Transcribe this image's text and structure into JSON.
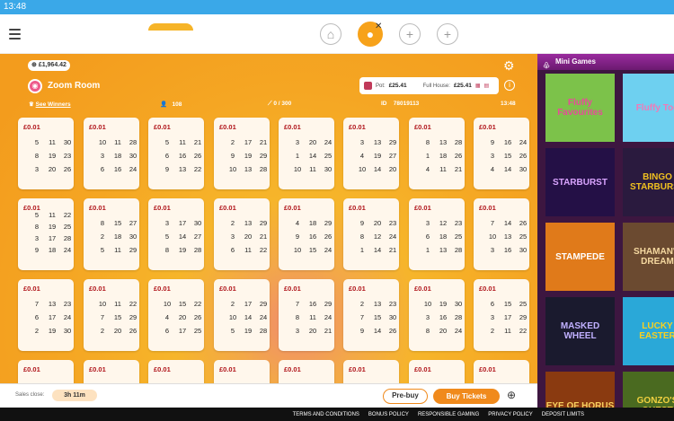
{
  "status": {
    "time": "13:48"
  },
  "nav": {
    "home_icon": "home-icon",
    "add_label": "+"
  },
  "room": {
    "balance": "£1,964.42",
    "title": "Zoom Room",
    "see_winners": "See Winners",
    "players": "108",
    "tickets": "0 / 300",
    "id_label": "ID",
    "id_value": "78019113",
    "time": "13:48",
    "pot_label": "Pot:",
    "pot_value": "£25.41",
    "full_house_label": "Full House:",
    "full_house_value": "£25.41"
  },
  "tickets": [
    {
      "price": "£0.01",
      "nums": [
        "5",
        "11",
        "30",
        "8",
        "19",
        "23",
        "3",
        "20",
        "26"
      ]
    },
    {
      "price": "£0.01",
      "nums": [
        "10",
        "11",
        "28",
        "3",
        "18",
        "30",
        "6",
        "16",
        "24"
      ]
    },
    {
      "price": "£0.01",
      "nums": [
        "5",
        "11",
        "21",
        "6",
        "16",
        "26",
        "9",
        "13",
        "22"
      ]
    },
    {
      "price": "£0.01",
      "nums": [
        "2",
        "17",
        "21",
        "9",
        "19",
        "29",
        "10",
        "13",
        "28"
      ]
    },
    {
      "price": "£0.01",
      "nums": [
        "3",
        "20",
        "24",
        "1",
        "14",
        "25",
        "10",
        "11",
        "30"
      ]
    },
    {
      "price": "£0.01",
      "nums": [
        "3",
        "13",
        "29",
        "4",
        "19",
        "27",
        "10",
        "14",
        "20"
      ]
    },
    {
      "price": "£0.01",
      "nums": [
        "8",
        "13",
        "28",
        "1",
        "18",
        "26",
        "4",
        "11",
        "21"
      ]
    },
    {
      "price": "£0.01",
      "nums": [
        "9",
        "16",
        "24",
        "3",
        "15",
        "26",
        "4",
        "14",
        "30"
      ]
    },
    {
      "price": "£0.01",
      "nums": [
        "5",
        "11",
        "22",
        "8",
        "19",
        "25",
        "3",
        "17",
        "28",
        "9",
        "18",
        "24"
      ]
    },
    {
      "price": "£0.01",
      "nums": [
        "8",
        "15",
        "27",
        "2",
        "18",
        "30",
        "5",
        "11",
        "29"
      ]
    },
    {
      "price": "£0.01",
      "nums": [
        "3",
        "17",
        "30",
        "5",
        "14",
        "27",
        "8",
        "19",
        "28"
      ]
    },
    {
      "price": "£0.01",
      "nums": [
        "2",
        "13",
        "29",
        "3",
        "20",
        "21",
        "6",
        "11",
        "22"
      ]
    },
    {
      "price": "£0.01",
      "nums": [
        "4",
        "18",
        "29",
        "9",
        "16",
        "26",
        "10",
        "15",
        "24"
      ]
    },
    {
      "price": "£0.01",
      "nums": [
        "9",
        "20",
        "23",
        "8",
        "12",
        "24",
        "1",
        "14",
        "21"
      ]
    },
    {
      "price": "£0.01",
      "nums": [
        "3",
        "12",
        "23",
        "6",
        "18",
        "25",
        "1",
        "13",
        "28"
      ]
    },
    {
      "price": "£0.01",
      "nums": [
        "7",
        "14",
        "26",
        "10",
        "13",
        "25",
        "3",
        "16",
        "30"
      ]
    },
    {
      "price": "£0.01",
      "nums": [
        "7",
        "13",
        "23",
        "6",
        "17",
        "24",
        "2",
        "19",
        "30"
      ]
    },
    {
      "price": "£0.01",
      "nums": [
        "10",
        "11",
        "22",
        "7",
        "15",
        "29",
        "2",
        "20",
        "26"
      ]
    },
    {
      "price": "£0.01",
      "nums": [
        "10",
        "15",
        "22",
        "4",
        "20",
        "26",
        "6",
        "17",
        "25"
      ]
    },
    {
      "price": "£0.01",
      "nums": [
        "2",
        "17",
        "29",
        "10",
        "14",
        "24",
        "5",
        "19",
        "28"
      ]
    },
    {
      "price": "£0.01",
      "nums": [
        "7",
        "16",
        "29",
        "8",
        "11",
        "24",
        "3",
        "20",
        "21"
      ]
    },
    {
      "price": "£0.01",
      "nums": [
        "2",
        "13",
        "23",
        "7",
        "15",
        "30",
        "9",
        "14",
        "26"
      ]
    },
    {
      "price": "£0.01",
      "nums": [
        "10",
        "19",
        "30",
        "3",
        "16",
        "28",
        "8",
        "20",
        "24"
      ]
    },
    {
      "price": "£0.01",
      "nums": [
        "6",
        "15",
        "25",
        "3",
        "17",
        "29",
        "2",
        "11",
        "22"
      ]
    },
    {
      "price": "£0.01",
      "nums": []
    },
    {
      "price": "£0.01",
      "nums": []
    },
    {
      "price": "£0.01",
      "nums": []
    },
    {
      "price": "£0.01",
      "nums": []
    },
    {
      "price": "£0.01",
      "nums": []
    },
    {
      "price": "£0.01",
      "nums": []
    },
    {
      "price": "£0.01",
      "nums": []
    },
    {
      "price": "£0.01",
      "nums": []
    }
  ],
  "bottom": {
    "sales_close_label": "Sales close:",
    "timer": "3h 11m",
    "prebuy": "Pre-buy",
    "buy": "Buy Tickets"
  },
  "mini_games": {
    "title": "Mini Games",
    "games": [
      {
        "name": "Fluffy Favourites",
        "bg": "#7cc24a",
        "color": "#e84b9a"
      },
      {
        "name": "Fluffy Too",
        "bg": "#6ed0f0",
        "color": "#f07ab8"
      },
      {
        "name": "STARBURST",
        "bg": "#241046",
        "color": "#d9a4ff"
      },
      {
        "name": "BINGO STARBURST",
        "bg": "#2a1a3e",
        "color": "#f0c020"
      },
      {
        "name": "STAMPEDE",
        "bg": "#e07a1a",
        "color": "#fff"
      },
      {
        "name": "SHAMAN'S DREAM",
        "bg": "#6b4a30",
        "color": "#f5d8a0"
      },
      {
        "name": "MASKED WHEEL",
        "bg": "#1a1a2e",
        "color": "#c0b0ff"
      },
      {
        "name": "LUCKY EASTER",
        "bg": "#2aa8d8",
        "color": "#f8d020"
      },
      {
        "name": "EYE OF HORUS",
        "bg": "#8a3a10",
        "color": "#f8d060"
      },
      {
        "name": "GONZO'S QUEST",
        "bg": "#4a6a20",
        "color": "#f0d040"
      }
    ]
  },
  "footer": {
    "links": [
      "TERMS AND CONDITIONS",
      "BONUS POLICY",
      "RESPONSIBLE GAMING",
      "PRIVACY POLICY",
      "DEPOSIT LIMITS"
    ]
  }
}
